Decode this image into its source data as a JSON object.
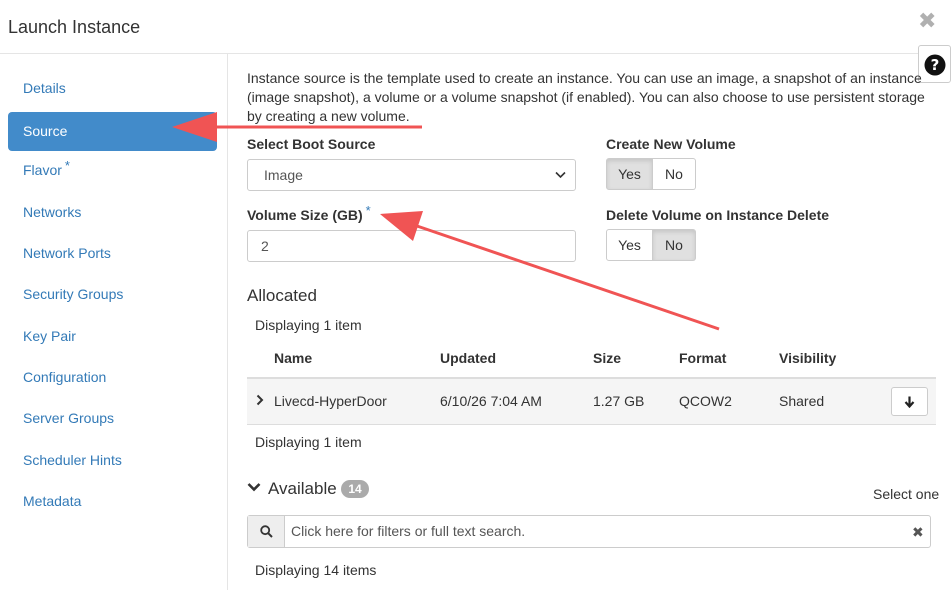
{
  "modal": {
    "title": "Launch Instance",
    "close_glyph": "✖",
    "help_glyph": "?"
  },
  "sidebar": {
    "items": [
      {
        "label": "Details",
        "active": false
      },
      {
        "label": "Source",
        "active": true
      },
      {
        "label": "Flavor",
        "required": "*"
      },
      {
        "label": "Networks"
      },
      {
        "label": "Network Ports"
      },
      {
        "label": "Security Groups"
      },
      {
        "label": "Key Pair"
      },
      {
        "label": "Configuration"
      },
      {
        "label": "Server Groups"
      },
      {
        "label": "Scheduler Hints"
      },
      {
        "label": "Metadata"
      }
    ]
  },
  "source": {
    "description": "Instance source is the template used to create an instance. You can use an image, a snapshot of an instance (image snapshot), a volume or a volume snapshot (if enabled). You can also choose to use persistent storage by creating a new volume.",
    "boot_source_label": "Select Boot Source",
    "boot_source_value": "Image",
    "create_volume_label": "Create New Volume",
    "create_volume_yes": "Yes",
    "create_volume_no": "No",
    "create_volume_selected": "Yes",
    "volume_size_label": "Volume Size (GB)",
    "volume_size_required": "*",
    "volume_size_value": "2",
    "delete_volume_label": "Delete Volume on Instance Delete",
    "delete_volume_yes": "Yes",
    "delete_volume_no": "No",
    "delete_volume_selected": "No"
  },
  "allocated": {
    "title": "Allocated",
    "count_top": "Displaying 1 item",
    "count_bottom": "Displaying 1 item",
    "columns": [
      "Name",
      "Updated",
      "Size",
      "Format",
      "Visibility"
    ],
    "rows": [
      {
        "name": "Livecd-HyperDoor",
        "updated": "6/10/26 7:04 AM",
        "size": "1.27 GB",
        "format": "QCOW2",
        "visibility": "Shared"
      }
    ]
  },
  "available": {
    "title": "Available",
    "badge": "14",
    "select_hint": "Select one",
    "search_placeholder": "Click here for filters or full text search.",
    "clear_glyph": "✖",
    "count": "Displaying 14 items"
  },
  "colors": {
    "accent": "#428bca",
    "link": "#337ab7",
    "annotation_arrow": "#f05454"
  },
  "icons": [
    "close-icon",
    "help-icon",
    "chevron-down-icon",
    "expand-icon",
    "arrow-down-icon",
    "search-icon",
    "clear-icon"
  ]
}
